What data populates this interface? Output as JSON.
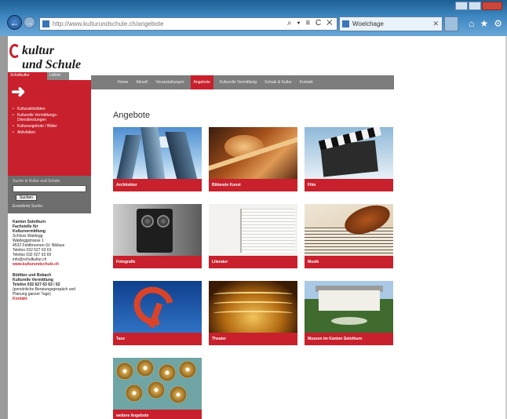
{
  "browser": {
    "url": "http://www.kulturundschule.ch/angebote",
    "addr_tools": "⌕ ▾ ≡ C ✕",
    "tab_title": "Woelchage",
    "tab_close": "✕",
    "icons": [
      "home-icon",
      "star-icon",
      "gear-icon"
    ]
  },
  "logo": {
    "line1": "kultur",
    "line2": "und Schule"
  },
  "sidebar": {
    "tabs": [
      "Schulkultur",
      "Lehrer"
    ],
    "nav": [
      "Kulturaktivitäten",
      "Kulturelle Vermittlungs-Dienstleistungen",
      "Kulturangebote / Bilder",
      "Aktivitäten"
    ],
    "search_label": "Suche in Kultur und Schule",
    "search_value": "",
    "search_button": "Suchen",
    "search_link": "Erweiterte Suche",
    "info": [
      {
        "text": "Kanton Solothurn",
        "style": "b"
      },
      {
        "text": "Fachstelle für",
        "style": "b"
      },
      {
        "text": "Kulturvermittlung",
        "style": "b"
      },
      {
        "text": "Schloss Waldegg",
        "style": ""
      },
      {
        "text": "Waldeggstrasse 1",
        "style": ""
      },
      {
        "text": "4532 Feldbrunnen-St. Niklaus",
        "style": ""
      },
      {
        "text": "Telefon 032 627 63 63",
        "style": ""
      },
      {
        "text": "Telefax 032 627 63 69",
        "style": ""
      },
      {
        "text": "info@schulkultur.ch",
        "style": ""
      },
      {
        "text": "www.kulturundschule.ch",
        "style": "red"
      },
      {
        "text": "",
        "style": "gap"
      },
      {
        "text": "Büttiker und Bobach",
        "style": "b"
      },
      {
        "text": "Kulturelle Vermittlung",
        "style": "b"
      },
      {
        "text": "Telefon 032 627 63 63 / 62",
        "style": "b"
      },
      {
        "text": "(persönliche Beratungsgespäch und",
        "style": ""
      },
      {
        "text": "Planung ganzer Tage)",
        "style": ""
      },
      {
        "text": "Kontakt",
        "style": "red"
      }
    ]
  },
  "topnav": [
    "Home",
    "Aktuell",
    "Veranstaltungen",
    "Angebote",
    "Kulturelle Vermittlung",
    "Schule & Kultur",
    "Kontakt"
  ],
  "topnav_active_index": 3,
  "main": {
    "heading": "Angebote",
    "tiles": [
      {
        "label": "Architektur",
        "image": "architektur"
      },
      {
        "label": "Bildende Kunst",
        "image": "bildende-kunst"
      },
      {
        "label": "Film",
        "image": "film"
      },
      {
        "label": "Fotografie",
        "image": "fotografie"
      },
      {
        "label": "Literatur",
        "image": "literatur"
      },
      {
        "label": "Musik",
        "image": "musik"
      },
      {
        "label": "Tanz",
        "image": "tanz"
      },
      {
        "label": "Theater",
        "image": "theater"
      },
      {
        "label": "Museen im Kanton Solothurn",
        "image": "museen"
      },
      {
        "label": "weitere Angebote",
        "image": "weitere"
      }
    ]
  },
  "colors": {
    "accent": "#c8202c",
    "nav_gray": "#7d7d7d",
    "side_gray": "#6e6e6e",
    "chrome_blue": "#2f74ad"
  }
}
